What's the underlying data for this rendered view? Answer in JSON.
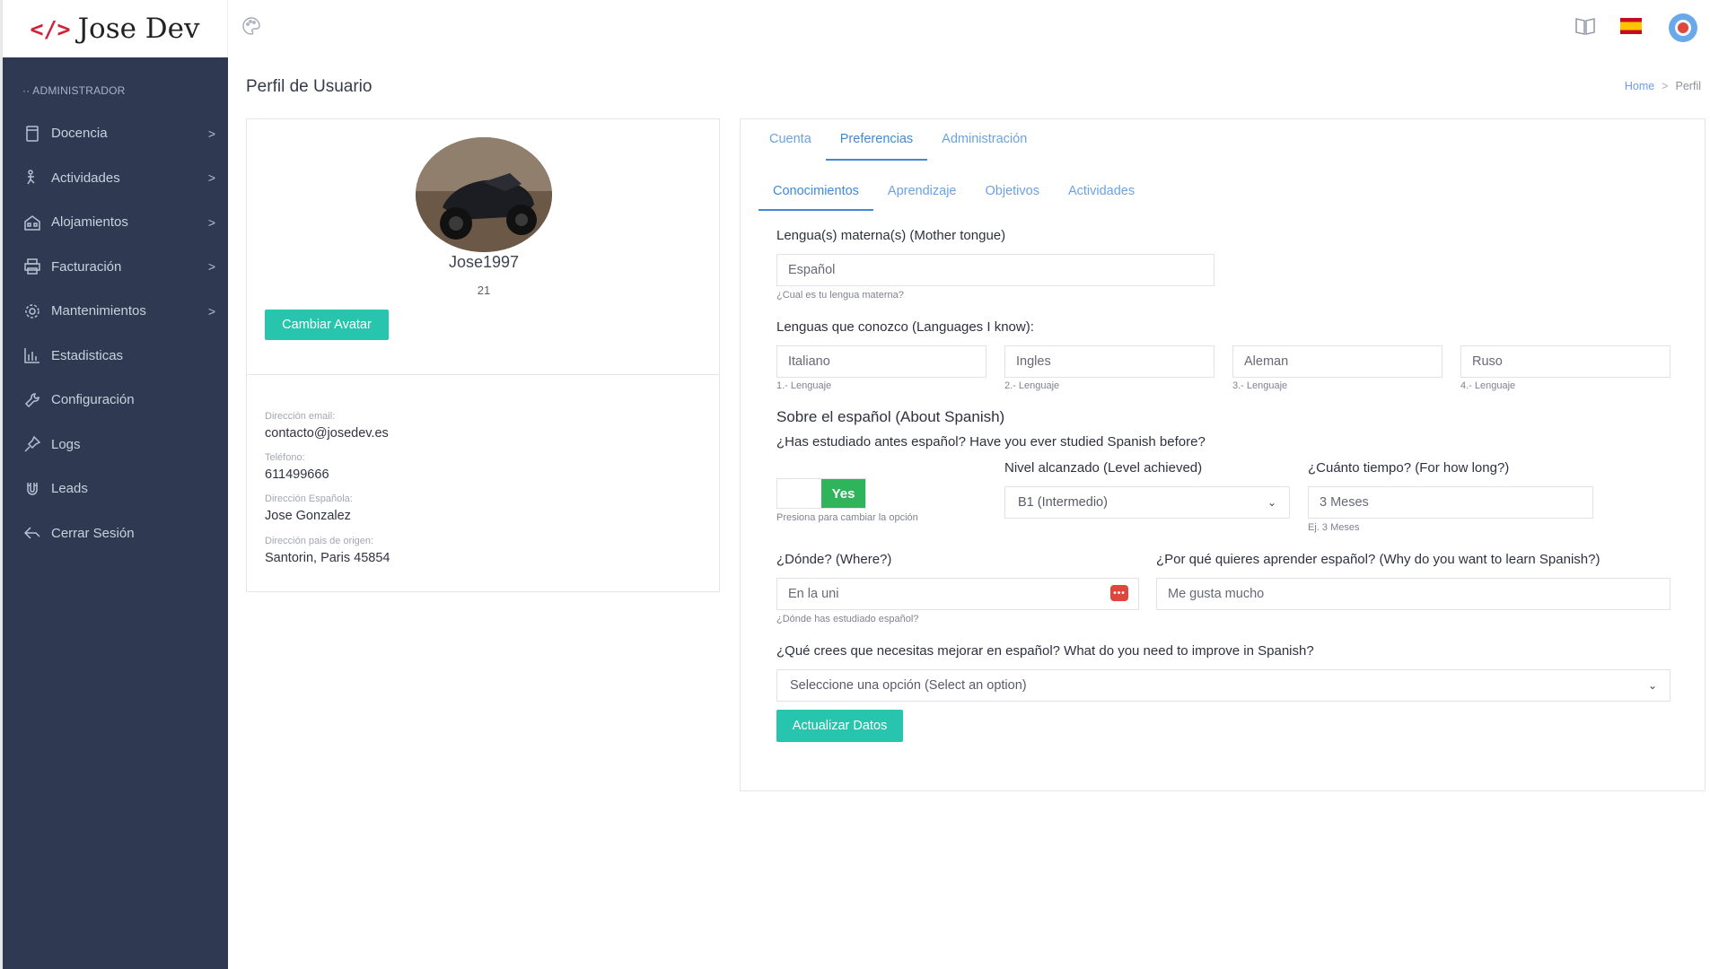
{
  "brand": {
    "icon": "</>",
    "name": "Jose Dev"
  },
  "sidebar": {
    "section_label": "·· ADMINISTRADOR",
    "items": [
      {
        "label": "Docencia",
        "icon": "document-icon",
        "has_children": true
      },
      {
        "label": "Actividades",
        "icon": "activity-icon",
        "has_children": true
      },
      {
        "label": "Alojamientos",
        "icon": "building-icon",
        "has_children": true
      },
      {
        "label": "Facturación",
        "icon": "printer-icon",
        "has_children": true
      },
      {
        "label": "Mantenimientos",
        "icon": "gear-icon",
        "has_children": true
      },
      {
        "label": "Estadisticas",
        "icon": "bar-chart-icon",
        "has_children": false
      },
      {
        "label": "Configuración",
        "icon": "wrench-icon",
        "has_children": false
      },
      {
        "label": "Logs",
        "icon": "pin-icon",
        "has_children": false
      },
      {
        "label": "Leads",
        "icon": "magnet-icon",
        "has_children": false
      },
      {
        "label": "Cerrar Sesión",
        "icon": "logout-icon",
        "has_children": false
      }
    ],
    "chevron": ">"
  },
  "topbar": {
    "icons": [
      "palette-icon",
      "book-icon",
      "spain-flag-icon",
      "user-avatar"
    ]
  },
  "page": {
    "title": "Perfil de Usuario",
    "breadcrumb": {
      "home": "Home",
      "separator": ">",
      "current": "Perfil"
    }
  },
  "profile": {
    "username": "Jose1997",
    "number": "21",
    "change_avatar_label": "Cambiar Avatar",
    "info": [
      {
        "label": "Dirección email:",
        "value": "contacto@josedev.es"
      },
      {
        "label": "Teléfono:",
        "value": "611499666"
      },
      {
        "label": "Dirección Española:",
        "value": "Jose Gonzalez"
      },
      {
        "label": "Dirección pais de origen:",
        "value": "Santorin, Paris 45854"
      }
    ]
  },
  "tabs": [
    {
      "label": "Cuenta",
      "active": false
    },
    {
      "label": "Preferencias",
      "active": true
    },
    {
      "label": "Administración",
      "active": false
    }
  ],
  "subtabs": [
    {
      "label": "Conocimientos",
      "active": true
    },
    {
      "label": "Aprendizaje",
      "active": false
    },
    {
      "label": "Objetivos",
      "active": false
    },
    {
      "label": "Actividades",
      "active": false
    }
  ],
  "form": {
    "mother_tongue": {
      "label": "Lengua(s) materna(s) (Mother tongue)",
      "value": "Español",
      "hint": "¿Cual es tu lengua materna?"
    },
    "known_languages": {
      "label": "Lenguas que conozco (Languages I know):",
      "items": [
        {
          "value": "Italiano",
          "hint": "1.- Lenguaje"
        },
        {
          "value": "Ingles",
          "hint": "2.- Lenguaje"
        },
        {
          "value": "Aleman",
          "hint": "3.- Lenguaje"
        },
        {
          "value": "Ruso",
          "hint": "4.- Lenguaje"
        }
      ]
    },
    "about_spanish": {
      "heading": "Sobre el español (About Spanish)",
      "question": "¿Has estudiado antes español? Have you ever studied Spanish before?",
      "toggle_label": "Yes",
      "toggle_hint": "Presiona para cambiar la opción",
      "level_label": "Nivel alcanzado (Level achieved)",
      "level_value": "B1 (Intermedio)",
      "duration_label": "¿Cuánto tiempo? (For how long?)",
      "duration_value": "3 Meses",
      "duration_hint": "Ej. 3 Meses"
    },
    "where": {
      "label": "¿Dónde? (Where?)",
      "value": "En la uni",
      "hint": "¿Dónde has estudiado español?"
    },
    "why": {
      "label": "¿Por qué quieres aprender español? (Why do you want to learn Spanish?)",
      "value": "Me gusta mucho"
    },
    "improve": {
      "label": "¿Qué crees que necesitas mejorar en español? What do you need to improve in Spanish?",
      "placeholder": "Seleccione una opción (Select an option)"
    },
    "submit_label": "Actualizar Datos"
  },
  "colors": {
    "sidebar_bg": "#2f3a52",
    "accent_teal": "#27c4ae",
    "tab_blue": "#3f8ad8",
    "toggle_green": "#2fb35b"
  }
}
